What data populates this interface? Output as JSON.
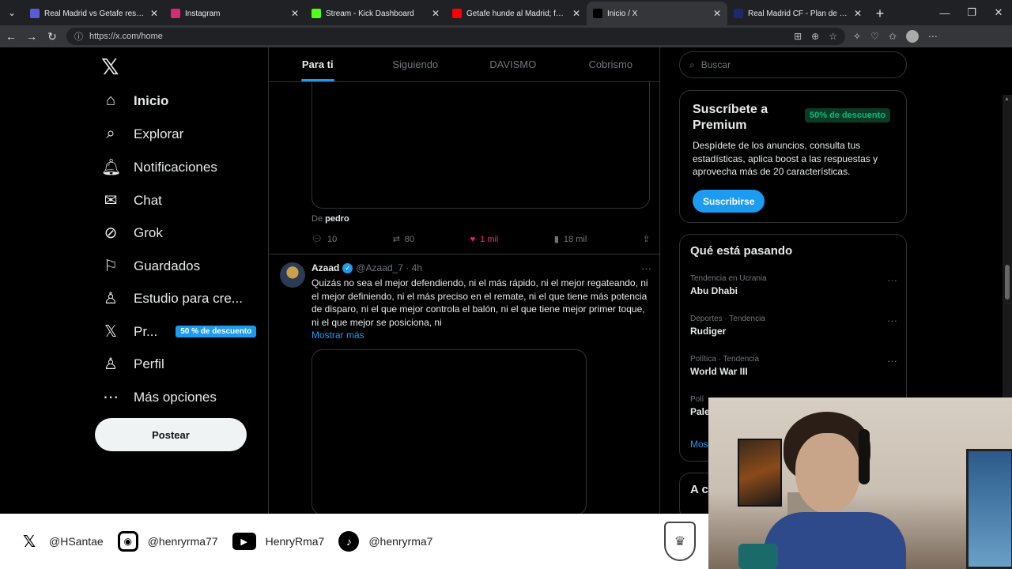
{
  "browser": {
    "tabs": [
      {
        "title": "Real Madrid vs Getafe resultados e",
        "favicon": "calendar-icon",
        "color": "#5b5bd6",
        "active": false
      },
      {
        "title": "Instagram",
        "favicon": "instagram-icon",
        "color": "#d62976",
        "active": false
      },
      {
        "title": "Stream - Kick Dashboard",
        "favicon": "kick-icon",
        "color": "#53fc18",
        "active": false
      },
      {
        "title": "Getafe hunde al Madrid; fuera Ma",
        "favicon": "youtube-icon",
        "color": "#ff0000",
        "active": false
      },
      {
        "title": "Inicio / X",
        "favicon": "x-icon",
        "color": "#000000",
        "active": true
      },
      {
        "title": "Real Madrid CF - Plan de encuentr",
        "favicon": "rm-icon",
        "color": "#1a2a6c",
        "active": false
      }
    ],
    "url": "https://x.com/home"
  },
  "sidebar": {
    "items": [
      {
        "label": "Inicio",
        "icon": "home-icon",
        "glyph": "⌂"
      },
      {
        "label": "Explorar",
        "icon": "search-icon",
        "glyph": "⌕"
      },
      {
        "label": "Notificaciones",
        "icon": "bell-icon",
        "glyph": "🔔︎"
      },
      {
        "label": "Chat",
        "icon": "mail-icon",
        "glyph": "✉"
      },
      {
        "label": "Grok",
        "icon": "grok-icon",
        "glyph": "⊘"
      },
      {
        "label": "Guardados",
        "icon": "bookmark-icon",
        "glyph": "⚐"
      },
      {
        "label": "Estudio para cre...",
        "icon": "creator-studio-icon",
        "glyph": "♙"
      },
      {
        "label": "Pr...",
        "icon": "x-premium-icon",
        "glyph": "𝕏"
      },
      {
        "label": "Perfil",
        "icon": "person-icon",
        "glyph": "♙"
      },
      {
        "label": "Más opciones",
        "icon": "more-circle-icon",
        "glyph": "⋯"
      }
    ],
    "premium_badge": "50 % de descuento",
    "post_button": "Postear"
  },
  "main": {
    "tabs": [
      "Para ti",
      "Siguiendo",
      "DAVISMO",
      "Cobrismo"
    ],
    "tweet1": {
      "from_prefix": "De",
      "from_user": "pedro",
      "replies": "10",
      "reposts": "80",
      "likes": "1 mil",
      "views": "18 mil"
    },
    "tweet2": {
      "name": "Azaad",
      "handle_time": "@Azaad_7 · 4h",
      "text": "Quizás no sea el mejor defendiendo, ni el más rápido, ni el mejor regateando, ni el mejor definiendo, ni el más preciso en el remate, ni el que tiene más potencia de disparo, ni el que mejor controla el balón, ni el que tiene mejor primer toque, ni el que mejor se posiciona, ni",
      "show_more": "Mostrar más"
    }
  },
  "right": {
    "search_placeholder": "Buscar",
    "premium": {
      "title": "Suscríbete a Premium",
      "discount": "50% de descuento",
      "body": "Despídete de los anuncios, consulta tus estadísticas, aplica boost a las respuestas y aprovecha más de 20 características.",
      "button": "Suscribirse"
    },
    "trends": {
      "title": "Qué está pasando",
      "items": [
        {
          "category": "Tendencia en Ucrania",
          "name": "Abu Dhabi"
        },
        {
          "category": "Deportes · Tendencia",
          "name": "Rudiger"
        },
        {
          "category": "Política · Tendencia",
          "name": "World War III"
        },
        {
          "category": "Polí",
          "name": "Pale"
        }
      ],
      "more": "Mos"
    },
    "next_card_title": "A c"
  },
  "overlay": {
    "socials": [
      {
        "icon": "x-icon",
        "handle": "@HSantae"
      },
      {
        "icon": "instagram-icon",
        "handle": "@henryrma77"
      },
      {
        "icon": "youtube-icon",
        "handle": "HenryRma7"
      },
      {
        "icon": "tiktok-icon",
        "handle": "@henryrma7"
      }
    ]
  }
}
